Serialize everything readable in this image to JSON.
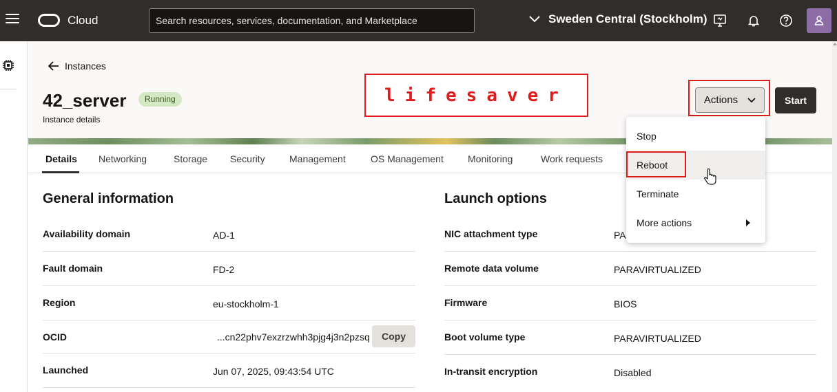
{
  "topbar": {
    "logo_text": "Cloud",
    "search_placeholder": "Search resources, services, documentation, and Marketplace",
    "region": "Sweden Central (Stockholm)",
    "icons": [
      "menu-icon",
      "monitor-icon",
      "bell-icon",
      "help-icon",
      "user-icon"
    ]
  },
  "header": {
    "back_label": "Instances",
    "title": "42_server",
    "status": "Running",
    "subtitle": "Instance details",
    "annotation": "lifesaver",
    "actions_label": "Actions",
    "start_label": "Start"
  },
  "tabs": [
    {
      "label": "Details",
      "active": true
    },
    {
      "label": "Networking"
    },
    {
      "label": "Storage"
    },
    {
      "label": "Security"
    },
    {
      "label": "Management"
    },
    {
      "label": "OS Management"
    },
    {
      "label": "Monitoring"
    },
    {
      "label": "Work requests"
    }
  ],
  "general": {
    "title": "General information",
    "rows": [
      {
        "label": "Availability domain",
        "value": "AD-1"
      },
      {
        "label": "Fault domain",
        "value": "FD-2"
      },
      {
        "label": "Region",
        "value": "eu-stockholm-1"
      },
      {
        "label": "OCID",
        "value": "...cn22phv7exzrzwhh3pjg4j3n2pzsq"
      },
      {
        "label": "Launched",
        "value": "Jun 07, 2025, 09:43:54 UTC"
      }
    ],
    "copy_label": "Copy"
  },
  "launch": {
    "title": "Launch options",
    "rows": [
      {
        "label": "NIC attachment type",
        "value": "PA"
      },
      {
        "label": "Remote data volume",
        "value": "PARAVIRTUALIZED"
      },
      {
        "label": "Firmware",
        "value": "BIOS"
      },
      {
        "label": "Boot volume type",
        "value": "PARAVIRTUALIZED"
      },
      {
        "label": "In-transit encryption",
        "value": "Disabled"
      }
    ]
  },
  "actions_menu": {
    "items": [
      "Stop",
      "Reboot",
      "Terminate",
      "More actions"
    ],
    "hovered": "Reboot"
  },
  "colors": {
    "topbar": "#312d2a",
    "highlight": "#e01b1b",
    "badge_bg": "#d4e8c4"
  }
}
